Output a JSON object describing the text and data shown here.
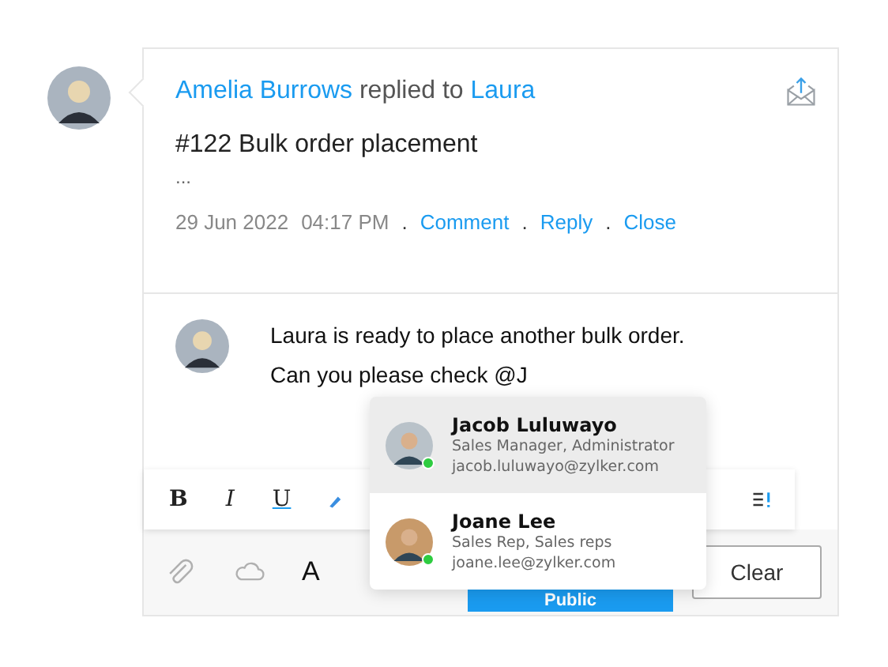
{
  "activity": {
    "author": "Amelia Burrows",
    "verb": "replied to",
    "recipient": "Laura",
    "subject": "#122 Bulk order placement",
    "more": "...",
    "date": "29 Jun 2022",
    "time": "04:17 PM",
    "separator": ".",
    "actions": [
      "Comment",
      "Reply",
      "Close"
    ]
  },
  "composer": {
    "lines": [
      "Laura is ready to place another bulk order.",
      "Can you please check @J"
    ],
    "toolbar": [
      {
        "kind": "bold",
        "label": "B"
      },
      {
        "kind": "italic",
        "label": "I"
      },
      {
        "kind": "underline",
        "label": "U"
      },
      {
        "kind": "color"
      },
      {
        "kind": "align"
      }
    ],
    "bottom": [
      {
        "kind": "attach"
      },
      {
        "kind": "cloud"
      },
      {
        "kind": "format",
        "label": "A"
      }
    ],
    "publish": "Public",
    "clear": "Clear"
  },
  "mentions": [
    {
      "name": "Jacob Luluwayo",
      "role": "Sales Manager, Administrator",
      "email": "jacob.luluwayo@zylker.com",
      "online": true,
      "selected": true
    },
    {
      "name": "Joane Lee",
      "role": "Sales Rep, Sales reps",
      "email": "joane.lee@zylker.com",
      "online": true,
      "selected": false
    }
  ]
}
